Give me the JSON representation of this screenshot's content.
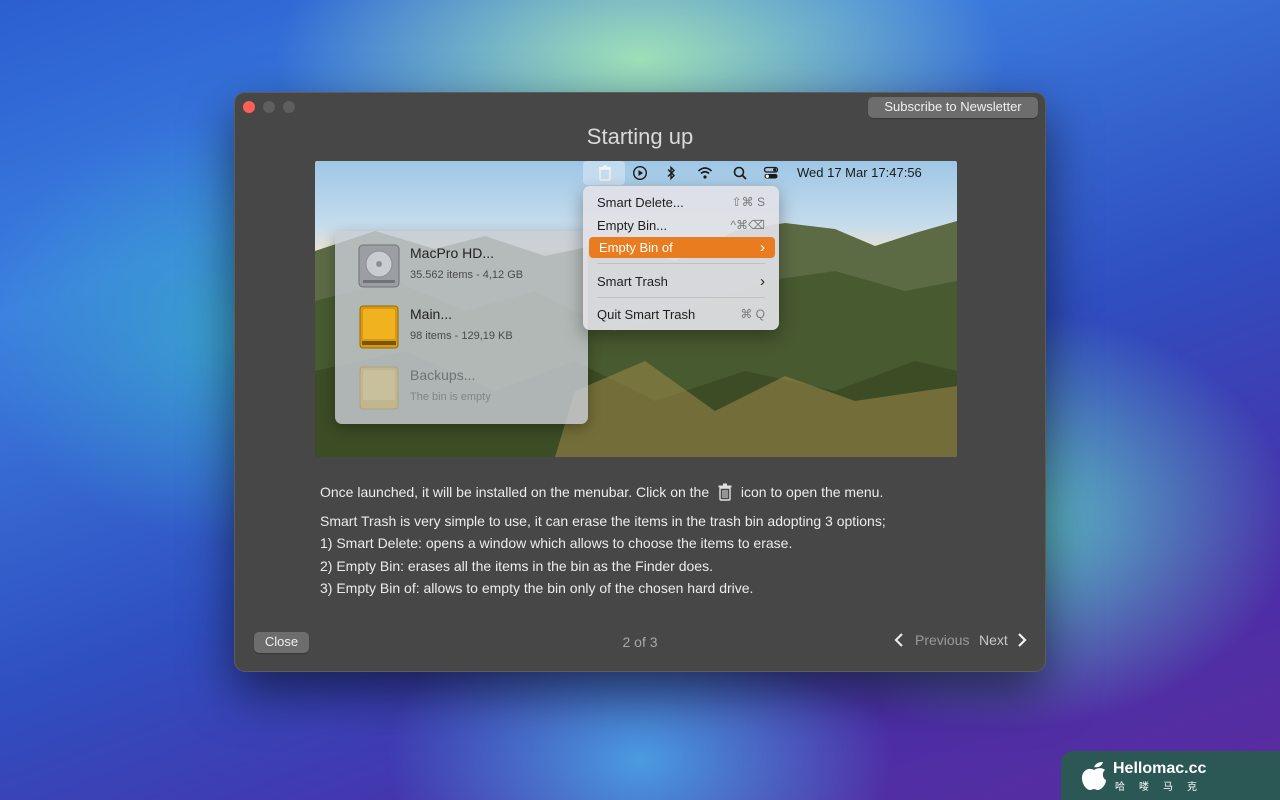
{
  "window": {
    "title": "Starting up",
    "subscribe_label": "Subscribe to Newsletter",
    "close_label": "Close",
    "pager": "2 of 3",
    "previous_label": "Previous",
    "next_label": "Next"
  },
  "screenshot": {
    "menubar_clock": "Wed 17 Mar  17:47:56",
    "menu": {
      "items": [
        {
          "label": "Smart Delete...",
          "shortcut": "⇧⌘ S"
        },
        {
          "label": "Empty Bin...",
          "shortcut": "^⌘⌫"
        },
        {
          "label": "Empty Bin of",
          "shortcut": "›"
        },
        {
          "label": "Smart Trash",
          "shortcut": "›"
        },
        {
          "label": "Quit Smart Trash",
          "shortcut": "⌘ Q"
        }
      ]
    },
    "drives": [
      {
        "name": "MacPro HD...",
        "meta": "35.562 items - 4,12 GB"
      },
      {
        "name": "Main...",
        "meta": "98 items - 129,19 KB"
      },
      {
        "name": "Backups...",
        "meta": "The bin is empty"
      }
    ]
  },
  "description": {
    "lead_before": "Once launched, it will be installed on the menubar. Click on the",
    "lead_after": "icon to open the menu.",
    "line1": "Smart Trash is very simple to use, it can erase the items in the trash bin adopting 3 options;",
    "line2": "1) Smart Delete: opens a window which allows to choose the items to erase.",
    "line3": "2) Empty Bin: erases all the items in the bin as the Finder does.",
    "line4": "3) Empty Bin of: allows to empty the bin only of the chosen hard drive."
  },
  "watermark": {
    "name": "Hellomac.cc",
    "sub": "哈喽马克"
  },
  "colors": {
    "accent": "#ea7c20",
    "window_bg": "#474747",
    "close_dot": "#fe5f57"
  }
}
